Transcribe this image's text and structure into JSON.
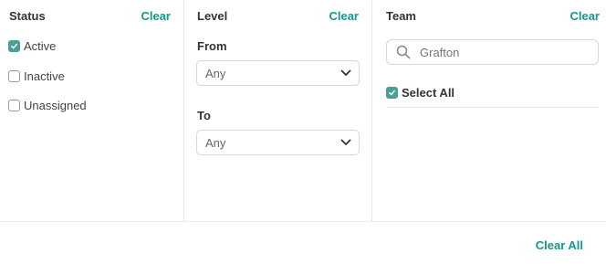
{
  "status": {
    "title": "Status",
    "clear_label": "Clear",
    "options": [
      {
        "label": "Active",
        "checked": true
      },
      {
        "label": "Inactive",
        "checked": false
      },
      {
        "label": "Unassigned",
        "checked": false
      }
    ]
  },
  "level": {
    "title": "Level",
    "clear_label": "Clear",
    "from_label": "From",
    "from_value": "Any",
    "to_label": "To",
    "to_value": "Any"
  },
  "team": {
    "title": "Team",
    "clear_label": "Clear",
    "search_placeholder": "Grafton",
    "select_all_label": "Select All",
    "select_all_checked": true
  },
  "footer": {
    "clear_all_label": "Clear All"
  },
  "colors": {
    "accent": "#17948c",
    "checkbox_checked": "#4a9e96"
  }
}
